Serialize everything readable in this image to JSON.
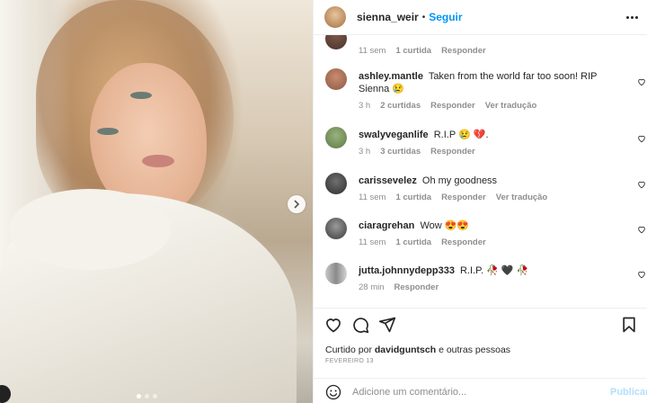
{
  "header": {
    "username": "sienna_weir",
    "separator": "•",
    "follow_label": "Seguir"
  },
  "comments": [
    {
      "user": "",
      "text": "",
      "time": "11 sem",
      "likes": "1 curtida",
      "reply": "Responder",
      "translate": ""
    },
    {
      "user": "ashley.mantle",
      "text": "Taken from the world far too soon! RIP Sienna 😢",
      "time": "3 h",
      "likes": "2 curtidas",
      "reply": "Responder",
      "translate": "Ver tradução"
    },
    {
      "user": "swalyveganlife",
      "text": "R.I.P 😢 💔.",
      "time": "3 h",
      "likes": "3 curtidas",
      "reply": "Responder",
      "translate": ""
    },
    {
      "user": "carissevelez",
      "text": "Oh my goodness",
      "time": "11 sem",
      "likes": "1 curtida",
      "reply": "Responder",
      "translate": "Ver tradução"
    },
    {
      "user": "ciaragrehan",
      "text": "Wow 😍😍",
      "time": "11 sem",
      "likes": "1 curtida",
      "reply": "Responder",
      "translate": ""
    },
    {
      "user": "jutta.johnnydepp333",
      "text": "R.I.P. 🥀 🖤 🥀",
      "time": "28 min",
      "likes": "",
      "reply": "Responder",
      "translate": ""
    }
  ],
  "liked": {
    "prefix": "Curtido por",
    "user": "davidguntsch",
    "suffix": "e outras pessoas"
  },
  "date": "FEVEREIRO 13",
  "compose": {
    "placeholder": "Adicione um comentário...",
    "publish_label": "Publicar"
  },
  "colors": {
    "link_blue": "#0095f6",
    "publish_disabled": "#b2dffc",
    "meta_gray": "#8e8e8e"
  },
  "icons": [
    "heart-icon",
    "comment-icon",
    "share-icon",
    "bookmark-icon",
    "emoji-icon",
    "more-icon",
    "chevron-right-icon"
  ]
}
